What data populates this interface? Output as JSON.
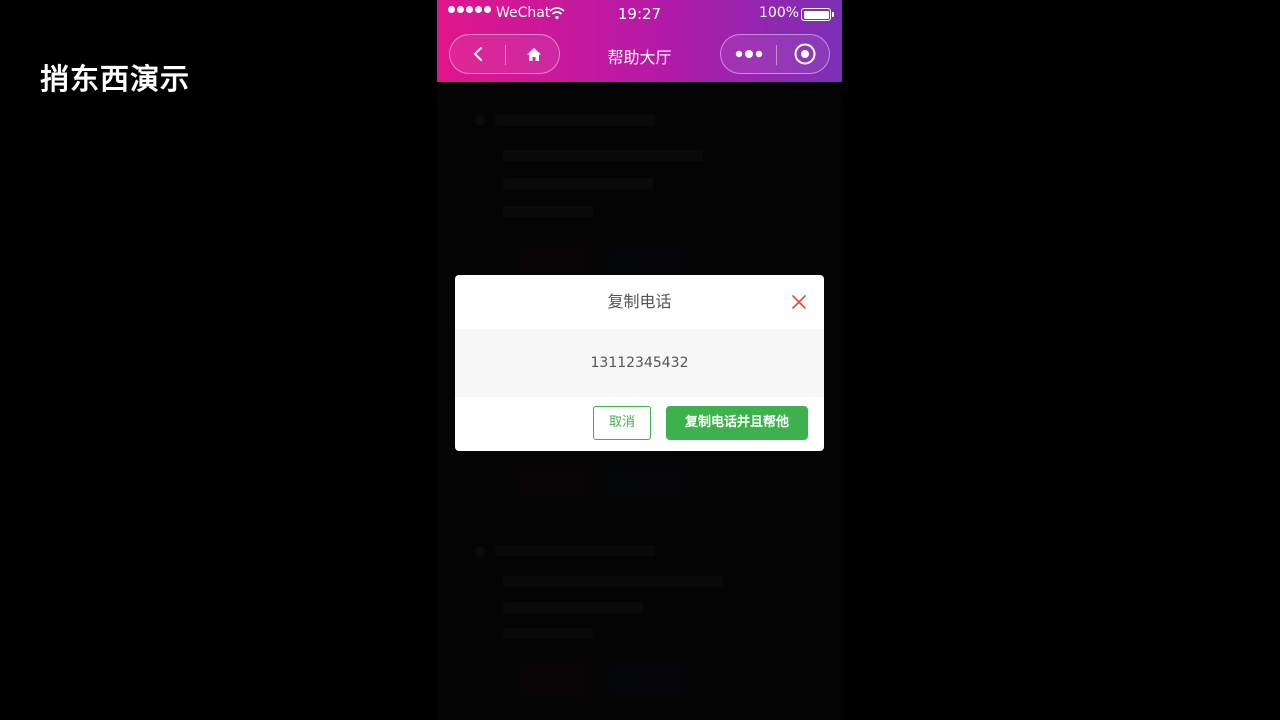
{
  "overlay_label": "捎东西演示",
  "status_bar": {
    "carrier": "WeChat",
    "time": "19:27",
    "battery": "100%"
  },
  "nav": {
    "title": "帮助大厅",
    "icons": [
      "back-icon",
      "home-icon",
      "more-icon",
      "close-miniprogram-icon"
    ]
  },
  "dialog": {
    "title": "复制电话",
    "phone": "13112345432",
    "cancel_label": "取消",
    "confirm_label": "复制电话并且帮他"
  },
  "colors": {
    "header_gradient_start": "#e0168c",
    "header_gradient_end": "#7b2fb6",
    "primary_green": "#3db14b",
    "close_icon": "#e2533f"
  }
}
